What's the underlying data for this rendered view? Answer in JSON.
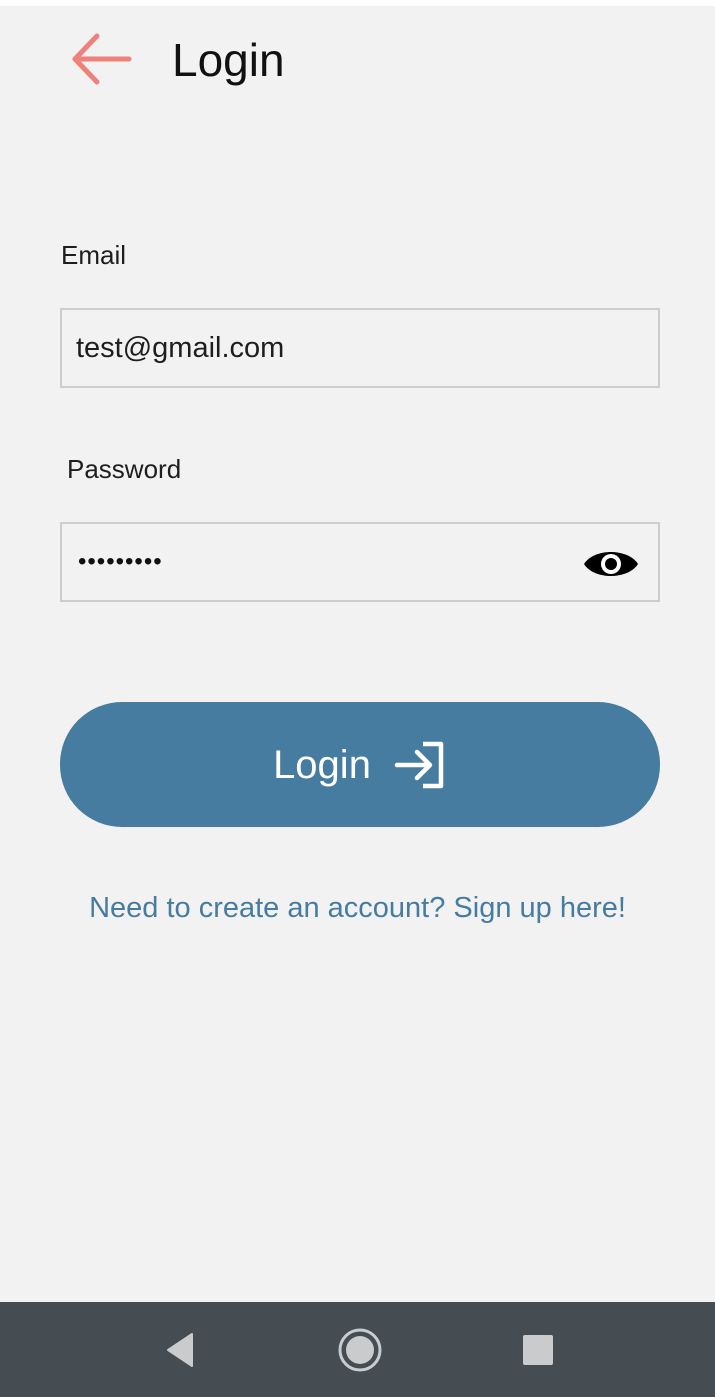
{
  "header": {
    "title": "Login",
    "back_icon": "arrow-left-icon",
    "back_icon_color": "#f0807a"
  },
  "form": {
    "email": {
      "label": "Email",
      "value": "test@gmail.com"
    },
    "password": {
      "label": "Password",
      "masked_value": "•••••••••",
      "toggle_icon": "eye-icon"
    }
  },
  "actions": {
    "login_label": "Login",
    "login_icon": "sign-in-icon",
    "login_color": "#467c9f",
    "signup_text": "Need to create an account? Sign up here!"
  },
  "system_nav": {
    "back_icon": "triangle-back-icon",
    "home_icon": "circle-home-icon",
    "recents_icon": "square-recents-icon"
  }
}
